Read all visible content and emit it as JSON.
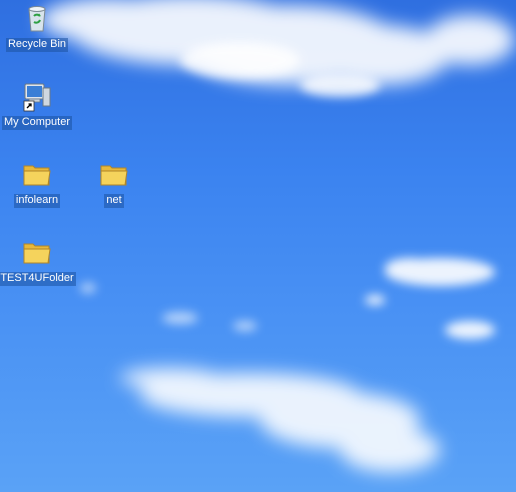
{
  "desktop": {
    "icons": [
      {
        "label": "Recycle Bin",
        "icon": "recycle-bin-icon"
      },
      {
        "label": "My Computer",
        "icon": "my-computer-icon"
      },
      {
        "label": "infolearn",
        "icon": "folder-icon"
      },
      {
        "label": "net",
        "icon": "folder-icon"
      },
      {
        "label": "TEST4UFolder",
        "icon": "folder-icon"
      }
    ]
  },
  "colors": {
    "sky_top": "#2f6fe0",
    "sky_bottom": "#5aa2f6",
    "label_background": "#1c52a0",
    "label_text": "#ffffff",
    "folder_yellow": "#f5d35c"
  }
}
